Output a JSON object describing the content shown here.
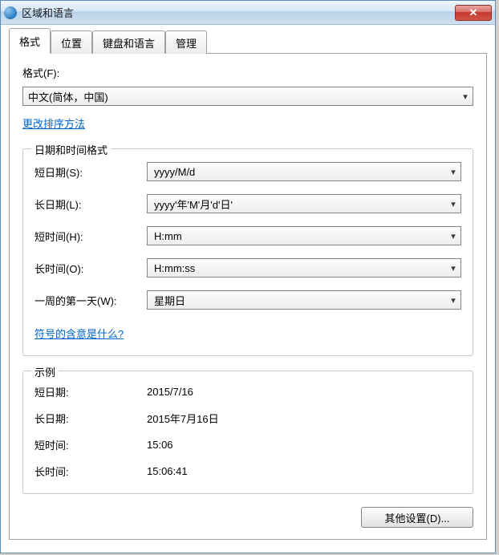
{
  "window": {
    "title": "区域和语言"
  },
  "tabs": {
    "format": "格式",
    "location": "位置",
    "keyboardsAndLanguages": "键盘和语言",
    "administrative": "管理"
  },
  "formatPanel": {
    "formatLabel": "格式(F):",
    "formatValue": "中文(简体，中国)",
    "changeSortLink": "更改排序方法",
    "dateTimeGroup": {
      "title": "日期和时间格式",
      "shortDateLabel": "短日期(S):",
      "shortDateValue": "yyyy/M/d",
      "longDateLabel": "长日期(L):",
      "longDateValue": "yyyy'年'M'月'd'日'",
      "shortTimeLabel": "短时间(H):",
      "shortTimeValue": "H:mm",
      "longTimeLabel": "长时间(O):",
      "longTimeValue": "H:mm:ss",
      "firstDayLabel": "一周的第一天(W):",
      "firstDayValue": "星期日",
      "notationHelpLink": "符号的含意是什么?"
    },
    "examplesGroup": {
      "title": "示例",
      "shortDateLabel": "短日期:",
      "shortDateValue": "2015/7/16",
      "longDateLabel": "长日期:",
      "longDateValue": "2015年7月16日",
      "shortTimeLabel": "短时间:",
      "shortTimeValue": "15:06",
      "longTimeLabel": "长时间:",
      "longTimeValue": "15:06:41"
    },
    "additionalSettingsButton": "其他设置(D)..."
  },
  "icons": {
    "dropdownArrow": "▾",
    "close": "✕"
  }
}
